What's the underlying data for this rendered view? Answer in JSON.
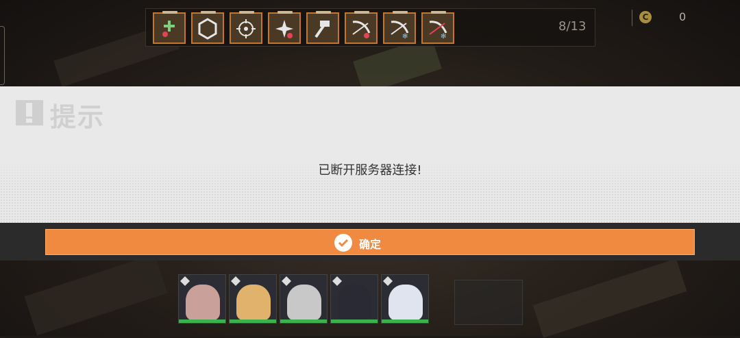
{
  "hud": {
    "item_icons": [
      "health-plus-icon",
      "hexagon-shield-icon",
      "crosshair-icon",
      "star-burst-icon",
      "hammer-icon",
      "bow-heart-icon",
      "bow-snow-icon",
      "bow-snow-icon-2"
    ],
    "item_count": "8/13",
    "coin_symbol": "C",
    "coin_value": "0"
  },
  "dialog": {
    "title": "提示",
    "message": "已断开服务器连接!",
    "confirm_label": "确定"
  },
  "squad": {
    "members": [
      {
        "class_icon": "snowflake-icon",
        "hair": "#c9a09a",
        "hp": 1.0
      },
      {
        "class_icon": "hammer-icon",
        "hair": "#e0b26c",
        "hp": 1.0
      },
      {
        "class_icon": "shield-icon",
        "hair": "#c8c8c8",
        "hp": 1.0
      },
      {
        "class_icon": "hammer-icon",
        "hair": "#2a2a35",
        "hp": 1.0
      },
      {
        "class_icon": "crosshair-icon",
        "hair": "#dfe4ee",
        "hp": 1.0
      }
    ]
  },
  "colors": {
    "accent": "#f08a40",
    "item_border": "#c4772e",
    "hp": "#3bb24e"
  }
}
